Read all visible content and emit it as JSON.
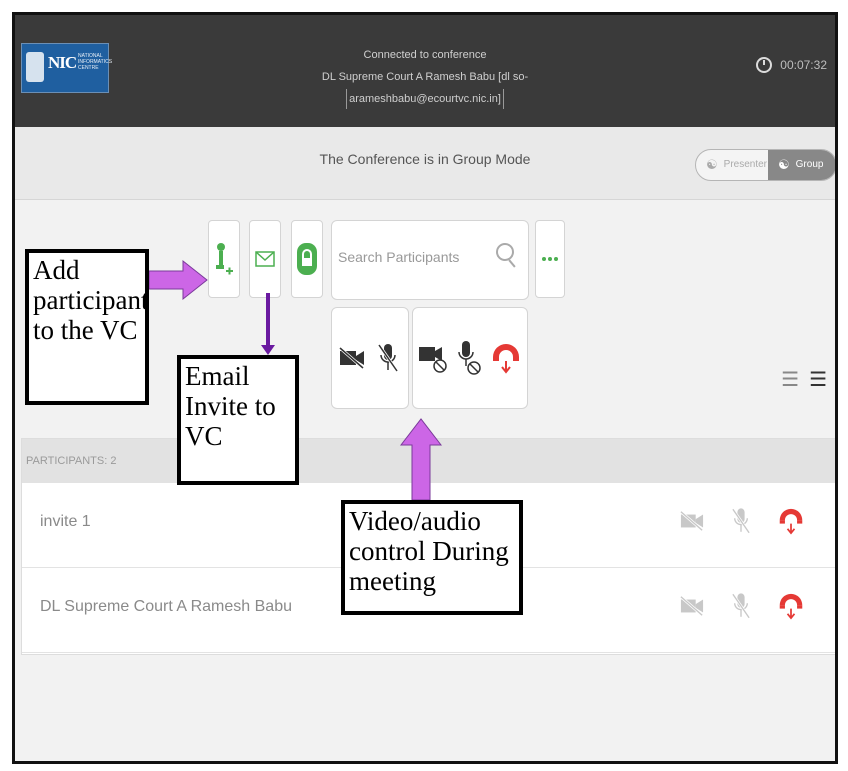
{
  "header": {
    "logo_mark": "NIC",
    "logo_org": "NATIONAL INFORMATICS CENTRE",
    "status_line1": "Connected to conference",
    "status_line2": "DL Supreme Court A Ramesh Babu [dl so-",
    "status_line3": "arameshbabu@ecourtvc.nic.in]",
    "timer": "00:07:32"
  },
  "mode": {
    "message": "The Conference is in Group Mode",
    "presenter_label": "Presenter",
    "group_label": "Group",
    "active": "Group"
  },
  "toolbar": {
    "search_placeholder": "Search Participants",
    "icons": [
      "add-participant-icon",
      "email-invite-icon",
      "lock-icon",
      "search-icon",
      "more-icon"
    ]
  },
  "controls": {
    "all": [
      "video-off-all-icon",
      "mic-off-all-icon"
    ],
    "self": [
      "video-block-icon",
      "mic-block-icon",
      "disconnect-icon"
    ]
  },
  "participants": {
    "header": "PARTICIPANTS: 2",
    "items": [
      {
        "name": "invite 1"
      },
      {
        "name": "DL Supreme Court A Ramesh Babu"
      }
    ]
  },
  "annotations": {
    "add": "Add participant to the VC",
    "email": "Email Invite to VC",
    "video": "Video/audio control During meeting"
  },
  "colors": {
    "header_bg": "#3a3a3a",
    "accent_green": "#4caf50",
    "disconnect_red": "#e53935",
    "arrow_purple": "#cc66e6",
    "arrow_dark_purple": "#6a1aa0"
  }
}
